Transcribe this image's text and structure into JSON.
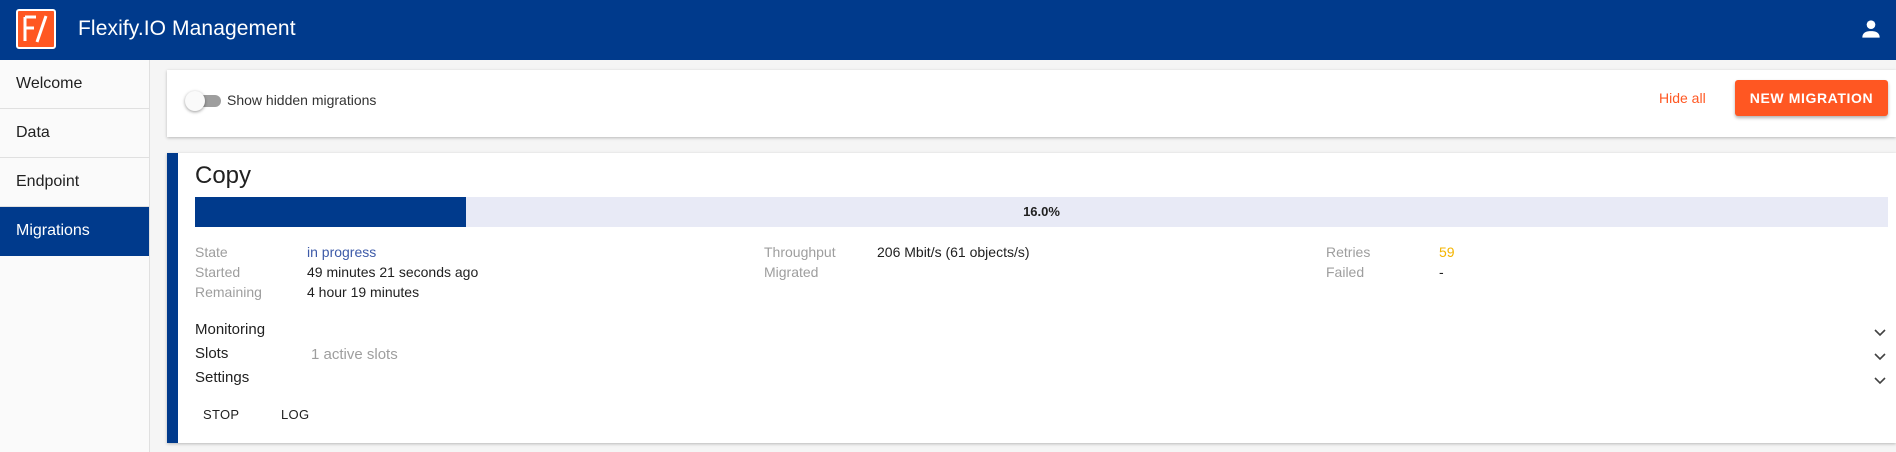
{
  "header": {
    "logo_text": "F/",
    "title": "Flexify.IO Management",
    "account_icon": "person-icon",
    "background": "#003a8c"
  },
  "sidebar": {
    "items": [
      {
        "label": "Welcome"
      },
      {
        "label": "Data"
      },
      {
        "label": "Endpoint"
      },
      {
        "label": "Migrations",
        "active": true
      }
    ]
  },
  "toolbar": {
    "toggle_label": "Show hidden migrations",
    "toggle_on": false,
    "hide_all_label": "Hide all",
    "new_migration_label": "NEW MIGRATION",
    "accent": "#ff5722"
  },
  "migration": {
    "title": "Copy",
    "progress_percent": 16.0,
    "progress_text": "16.0%",
    "stats": {
      "state_label": "State",
      "state_value": "in progress",
      "started_label": "Started",
      "started_value": "49 minutes 21 seconds ago",
      "remaining_label": "Remaining",
      "remaining_value": "4 hour 19 minutes",
      "throughput_label": "Throughput",
      "throughput_value": "206 Mbit/s (61 objects/s)",
      "migrated_label": "Migrated",
      "migrated_value": "",
      "retries_label": "Retries",
      "retries_value": "59",
      "failed_label": "Failed",
      "failed_value": "-"
    },
    "sections": {
      "monitoring": "Monitoring",
      "slots": "Slots",
      "slots_sub": "1 active slots",
      "settings": "Settings"
    },
    "actions": {
      "stop": "STOP",
      "log": "LOG"
    }
  }
}
